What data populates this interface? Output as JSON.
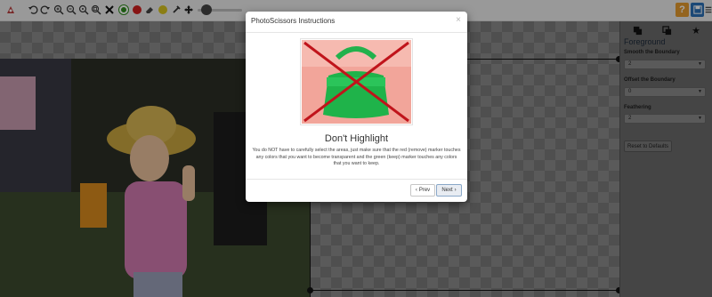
{
  "toolbar": {
    "icons": [
      "app-logo-icon",
      "undo-icon",
      "redo-icon",
      "zoom-in-icon",
      "zoom-out-icon",
      "zoom-actual-icon",
      "zoom-fit-icon",
      "remove-tool-icon",
      "keep-marker-icon",
      "remove-marker-icon",
      "eraser-icon",
      "highlighter-icon",
      "dropper-icon",
      "move-icon"
    ],
    "brush_size_fraction": 0.2,
    "help_label": "?",
    "save_icon": "save-icon",
    "menu_icon": "menu-icon"
  },
  "colors": {
    "keep": "#2e8b1e",
    "remove": "#d01f1f",
    "help": "#e39a2f",
    "save": "#2a6fb5",
    "accent_marker_yellow": "#d6c21f"
  },
  "panel": {
    "tabs": [
      "foreground-tab-icon",
      "background-tab-icon",
      "star-tab-icon"
    ],
    "title": "Foreground",
    "smooth_label": "Smooth the Boundary",
    "smooth_value": "2",
    "offset_label": "Offset the Boundary",
    "offset_value": "0",
    "feather_label": "Feathering",
    "feather_value": "2",
    "reset_label": "Reset to Defaults"
  },
  "modal": {
    "title": "PhotoScissors Instructions",
    "close": "×",
    "heading": "Don't Highlight",
    "text": "You do NOT have to carefully select the areas, just make sure that the red (remove) marker touches any colors that you want to become transparent and the green (keep) marker touches any colors that you want to keep.",
    "prev_label": "Prev",
    "next_label": "Next"
  }
}
